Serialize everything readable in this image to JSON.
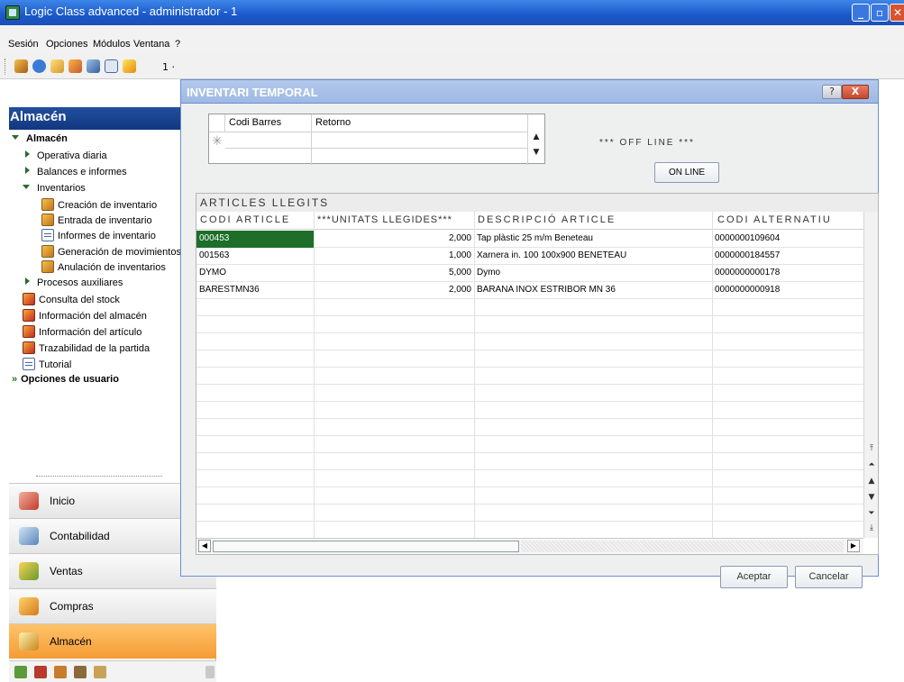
{
  "window": {
    "title": "Logic Class advanced - administrador - 1"
  },
  "menu": [
    "Sesión",
    "Opciones",
    "Módulos",
    "Ventana",
    "?"
  ],
  "toolbar": {
    "partial_text": "1 ·"
  },
  "sidebar": {
    "header": "Almacén",
    "tree": {
      "root": "Almacén",
      "operativa": "Operativa diaria",
      "balances": "Balances e informes",
      "inventarios": "Inventarios",
      "inv_items": [
        "Creación de inventario",
        "Entrada de inventario",
        "Informes de inventario",
        "Generación de movimientos",
        "Anulación de inventarios"
      ],
      "procesos": "Procesos auxiliares",
      "links": [
        "Consulta del stock",
        "Información del almacén",
        "Información del artículo",
        "Trazabilidad de la partida",
        "Tutorial"
      ],
      "user_options": "Opciones de usuario"
    },
    "nav": [
      "Inicio",
      "Contabilidad",
      "Ventas",
      "Compras",
      "Almacén"
    ]
  },
  "dialog": {
    "title": "INVENTARI TEMPORAL",
    "help": "?",
    "close": "X",
    "barcode_grid": {
      "col1": "Codi Barres",
      "col2": "Retorno",
      "new_row_marker": "✳"
    },
    "status": "*** OFF LINE ***",
    "online_button": "ON LINE",
    "articles": {
      "caption": "ARTICLES LLEGITS",
      "headers": [
        "CODI ARTICLE",
        "***UNITATS LLEGIDES***",
        "DESCRIPCIÓ ARTICLE",
        "CODI ALTERNATIU"
      ],
      "rows": [
        [
          "000453",
          "2,000",
          "Tap plàstic 25 m/m Beneteau",
          "0000000109604"
        ],
        [
          "001563",
          "1,000",
          "Xarnera in. 100 100x900 BENETEAU",
          "0000000184557"
        ],
        [
          "DYMO",
          "5,000",
          "Dymo",
          "0000000000178"
        ],
        [
          "BARESTMN36",
          "2,000",
          "BARANA INOX ESTRIBOR MN 36",
          "0000000000918"
        ]
      ]
    },
    "ok_button": "Aceptar",
    "cancel_button": "Cancelar"
  },
  "colors": {
    "selected_cell": "#1c6e28",
    "sidebar_header": "#214f9f",
    "active_nav": "#f59b35"
  }
}
